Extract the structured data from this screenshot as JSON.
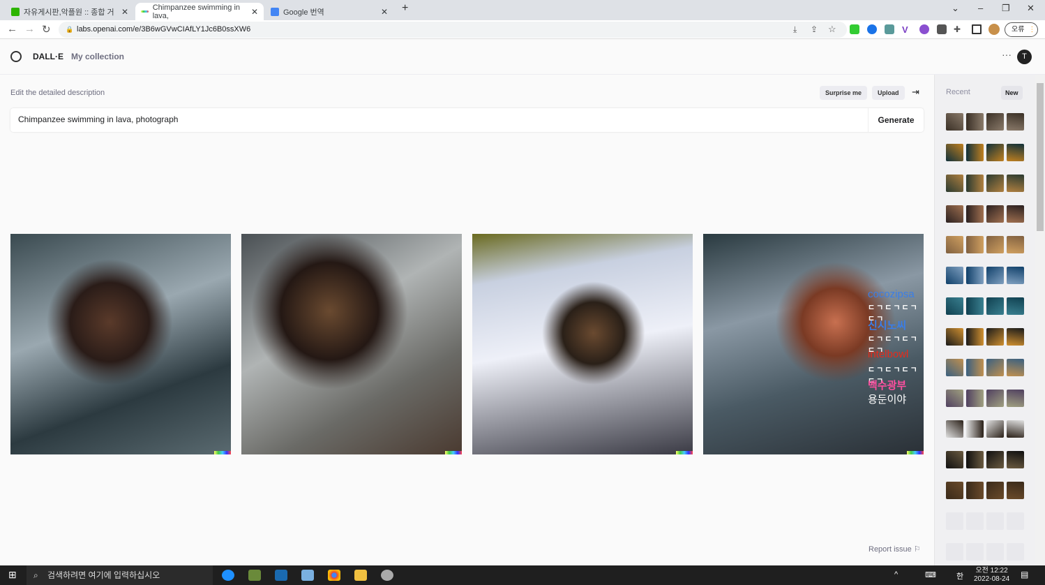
{
  "browser": {
    "tabs": [
      {
        "label": "자유게시판,악플원 :: 종합 거",
        "active": false
      },
      {
        "label": "Chimpanzee swimming in lava,",
        "active": true
      },
      {
        "label": "Google 번역",
        "active": false
      }
    ],
    "url": "labs.openai.com/e/3B6wGVwCIAfLY1Jc6B0ssXW6",
    "profile_label": "오류"
  },
  "header": {
    "brand": "DALL·E",
    "my_collection": "My collection",
    "avatar_initial": "T"
  },
  "editor": {
    "label": "Edit the detailed description",
    "surprise_me": "Surprise me",
    "upload": "Upload",
    "prompt_value": "Chimpanzee swimming in lava, photograph",
    "generate": "Generate"
  },
  "overlay": {
    "lines": [
      "cocozipsa",
      "ㄷㄱㄷㄱㄷㄱㄷㄱ",
      "신시노씨",
      "ㄷㄱㄷㄱㄷㄱㄷㄱ",
      "intelbowl",
      "ㄷㄱㄷㄱㄷㄱㄷㄱ",
      "백수광부",
      "용둔이야"
    ],
    "colors": [
      "#3a7ee8",
      "#ffffff",
      "#3a7ee8",
      "#ffffff",
      "#e82a1a",
      "#ffffff",
      "#ff4fa0",
      "#ffffff"
    ]
  },
  "report_issue": "Report issue",
  "sidebar": {
    "recent": "Recent",
    "new": "New"
  },
  "taskbar": {
    "search_placeholder": "검색하려면 여기에 입력하십시오",
    "time": "오전 12:22",
    "date": "2022-08-24",
    "ime": "한"
  }
}
